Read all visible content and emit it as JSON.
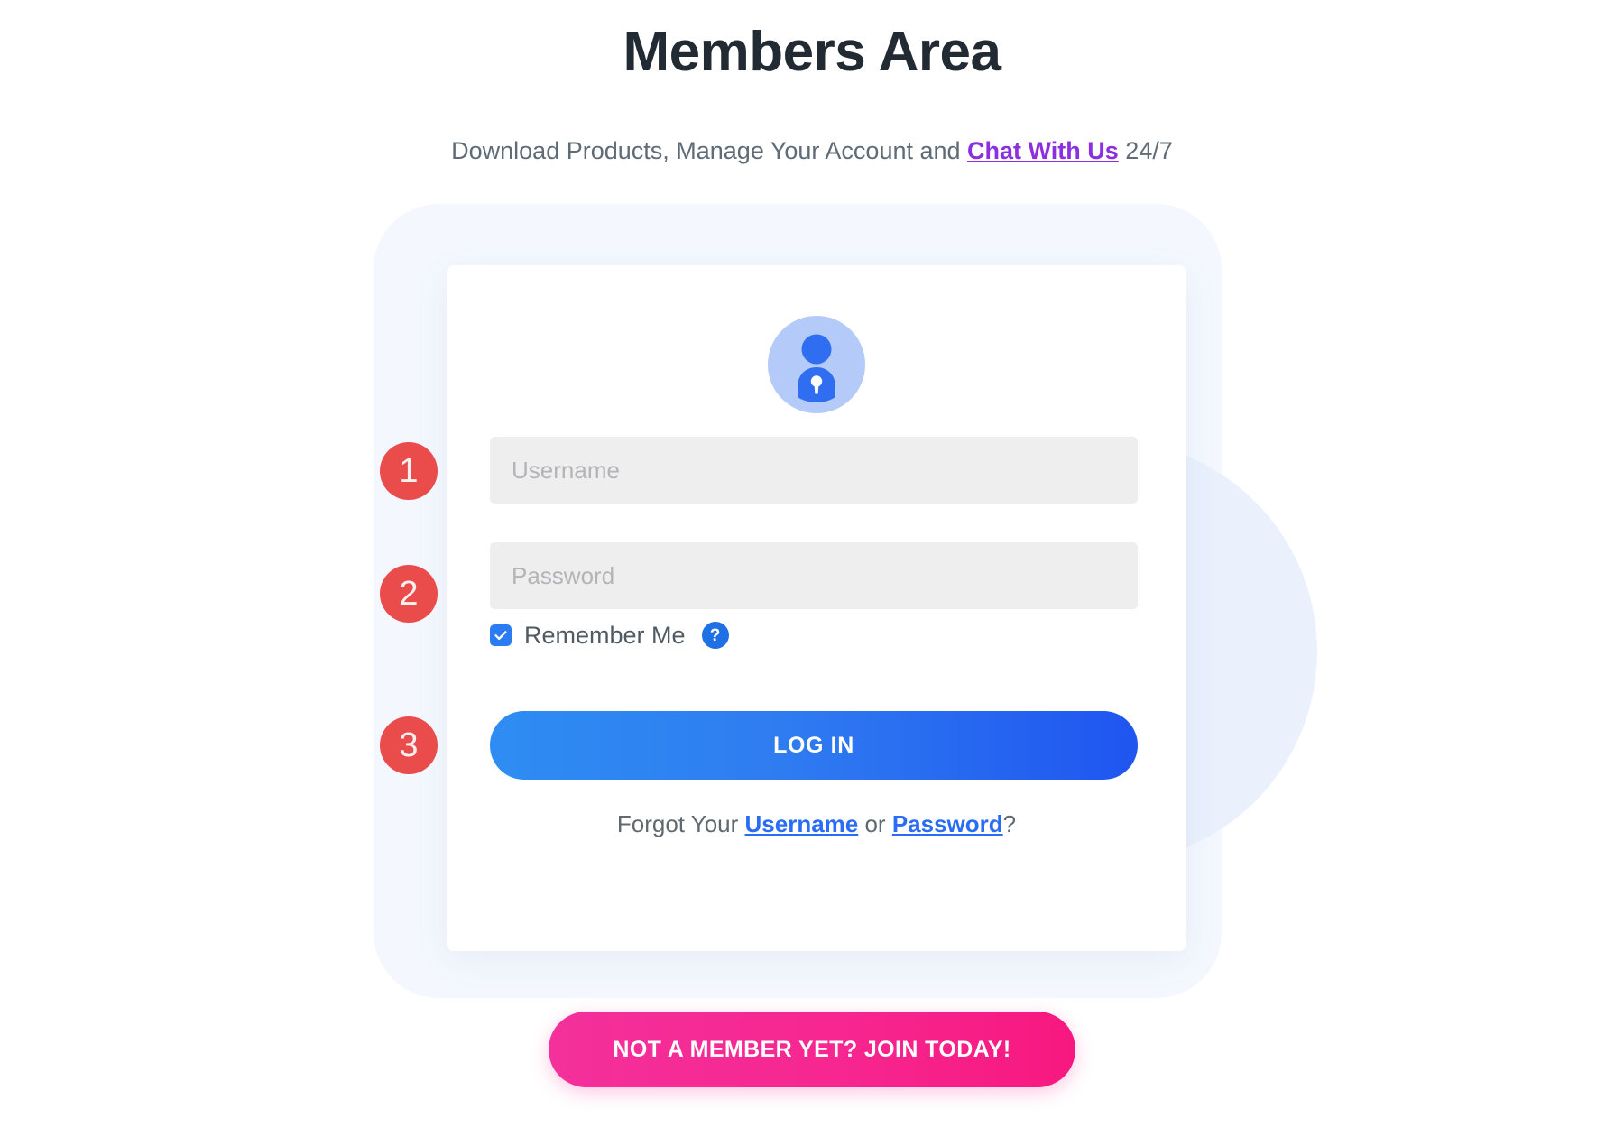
{
  "header": {
    "title": "Members Area",
    "subtitle_prefix": "Download Products, Manage Your Account and ",
    "subtitle_link": "Chat With Us",
    "subtitle_suffix": " 24/7"
  },
  "card": {
    "avatar_icon": "user-lock-icon",
    "steps": {
      "one": "1",
      "two": "2",
      "three": "3"
    },
    "username": {
      "placeholder": "Username",
      "value": ""
    },
    "password": {
      "placeholder": "Password",
      "value": ""
    },
    "remember": {
      "label": "Remember Me",
      "checked": true,
      "help_icon": "?"
    },
    "login_label": "LOG IN",
    "forgot": {
      "prefix": "Forgot Your ",
      "username_link": "Username",
      "separator": " or ",
      "password_link": "Password",
      "suffix": "?"
    }
  },
  "cta": {
    "join_label": "NOT A MEMBER YET? JOIN TODAY!"
  },
  "colors": {
    "title": "#222b33",
    "subtitle": "#5f6b76",
    "chat_link": "#8b2fe0",
    "step_badge": "#ea4c4c",
    "login_gradient_start": "#2e8df2",
    "login_gradient_end": "#1f55f0",
    "join_gradient_start": "#f4309b",
    "join_gradient_end": "#f7187f",
    "forgot_link": "#2a6df4",
    "checkbox": "#2b7cf3",
    "help_icon": "#1f6fe5",
    "avatar_circle": "#b4caf9",
    "avatar_glyph": "#2f6ef0",
    "field_bg": "#eeeeef",
    "card_bg": "#ffffff",
    "backdrop": "#f4f8fe",
    "backdrop_circle": "#eaf1fd"
  }
}
